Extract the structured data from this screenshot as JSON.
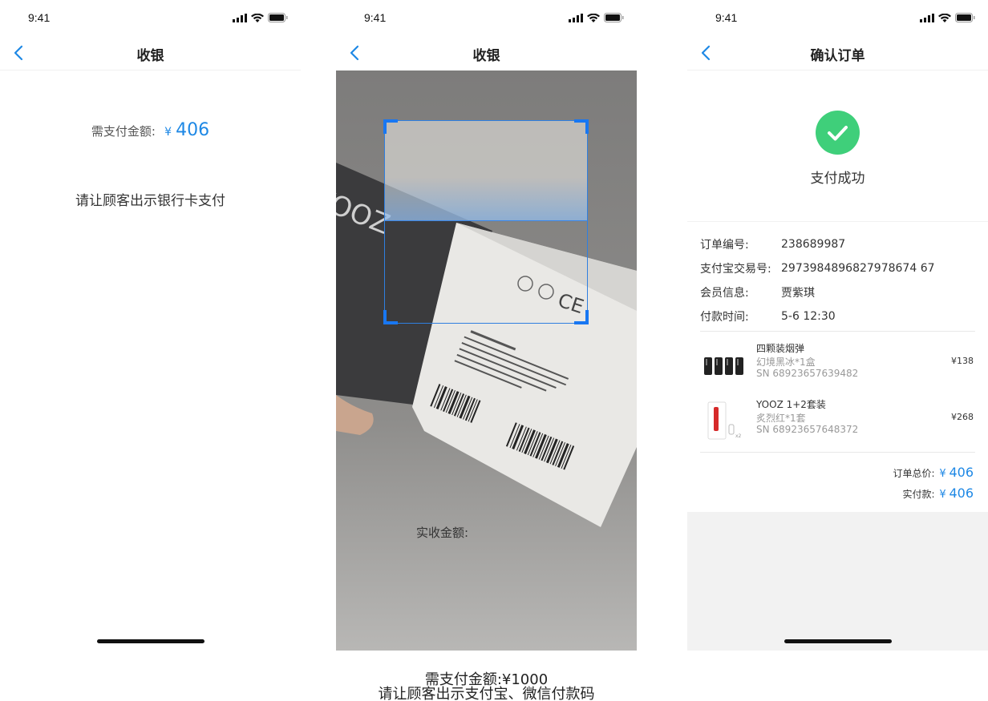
{
  "status_bar": {
    "time": "9:41"
  },
  "screen1": {
    "nav_title": "收银",
    "amount_label": "需支付金额:",
    "currency": "¥",
    "amount": "406",
    "instruction": "请让顾客出示银行卡支付"
  },
  "screen2": {
    "nav_title": "收银",
    "received_label": "实收金额:",
    "caption_amount": "需支付金额:¥1000",
    "caption_instruction": "请让顾客出示支付宝、微信付款码"
  },
  "screen3": {
    "nav_title": "确认订单",
    "success_text": "支付成功",
    "info": [
      {
        "key": "订单编号:",
        "value": "238689987"
      },
      {
        "key": "支付宝交易号:",
        "value": "2973984896827978674 67"
      },
      {
        "key": "会员信息:",
        "value": "贾紫琪"
      },
      {
        "key": "付款时间:",
        "value": "5-6 12:30"
      }
    ],
    "items": [
      {
        "name": "四颗装烟弹",
        "sub": "幻境黑冰*1盒",
        "sn": "SN 68923657639482",
        "price": "¥138"
      },
      {
        "name": "YOOZ 1+2套装",
        "sub": "炙烈红*1套",
        "sn": "SN 68923657648372",
        "price": "¥268"
      }
    ],
    "order_total_label": "订单总价:",
    "order_total": "406",
    "paid_label": "实付款:",
    "paid": "406",
    "currency": "¥"
  },
  "colors": {
    "accent": "#1e88e5",
    "success": "#3fcf7a",
    "scan": "#1877f2"
  }
}
